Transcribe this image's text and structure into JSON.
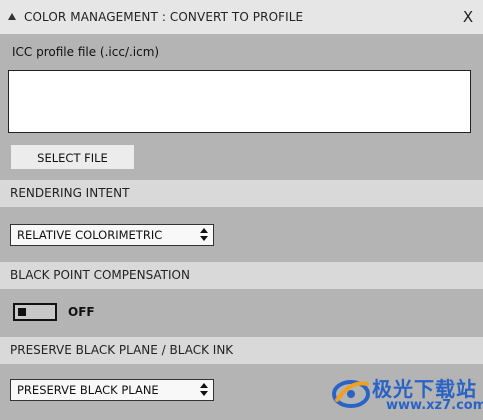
{
  "window": {
    "title": "COLOR MANAGEMENT : CONVERT TO PROFILE",
    "close_label": "X"
  },
  "icc": {
    "label": "ICC profile file (.icc/.icm)",
    "value": "",
    "select_button": "SELECT FILE"
  },
  "rendering_intent": {
    "header": "RENDERING INTENT",
    "selected": "RELATIVE COLORIMETRIC"
  },
  "black_point": {
    "header": "BLACK POINT COMPENSATION",
    "toggle_state": "OFF"
  },
  "preserve_black": {
    "header": "PRESERVE BLACK PLANE / BLACK INK",
    "selected": "PRESERVE BLACK PLANE"
  },
  "watermark": {
    "brand": "极光下载站",
    "url": "www.xz7.com"
  },
  "colors": {
    "panel_bg": "#b4b4b4",
    "header_bg": "#d9d9d9",
    "titlebar_bg": "#e6e6e6",
    "watermark_blue": "#2a63c6"
  }
}
